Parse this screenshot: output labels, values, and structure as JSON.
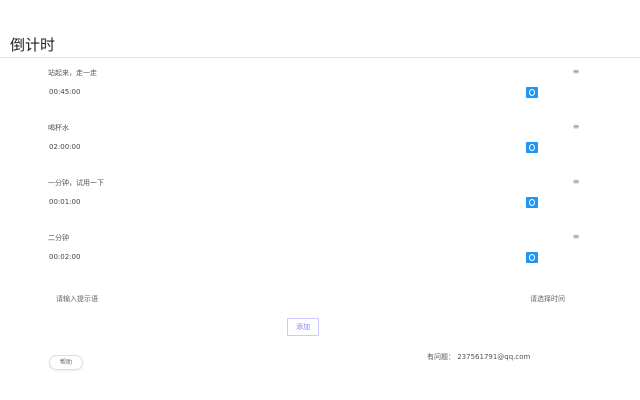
{
  "header": {
    "title": "倒计时"
  },
  "timers": [
    {
      "name": "站起来，走一走",
      "time": "00:45:00"
    },
    {
      "name": "喝杯水",
      "time": "02:00:00"
    },
    {
      "name": "一分钟，试用一下",
      "time": "00:01:00"
    },
    {
      "name": "二分钟",
      "time": "00:02:00"
    }
  ],
  "icons": {
    "delete": "delete-icon",
    "start": "play-icon"
  },
  "form": {
    "name_placeholder": "请输入提示语",
    "time_placeholder": "请选择时间",
    "add_label": "添加"
  },
  "footer": {
    "help_label": "帮助",
    "contact": "有问题：  237561791@qq.com"
  },
  "colors": {
    "accent": "#2196f3",
    "add_border": "#c9c9ff"
  }
}
